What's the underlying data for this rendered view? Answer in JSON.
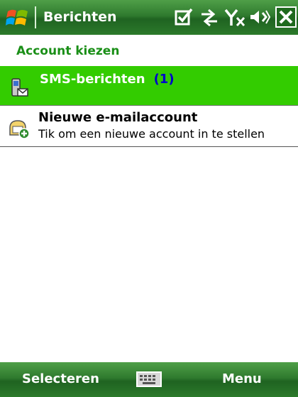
{
  "titlebar": {
    "title": "Berichten",
    "start_icon": "windows-flag-icon",
    "status_icons": [
      "checkbox-icon",
      "connectivity-arrows-icon",
      "no-signal-icon",
      "volume-icon",
      "close-icon"
    ]
  },
  "subheader": {
    "text": "Account kiezen"
  },
  "accounts": [
    {
      "icon": "sms-phone-icon",
      "label": "SMS-berichten",
      "count": "(1)"
    },
    {
      "icon": "new-email-account-icon",
      "title": "Nieuwe e-mailaccount",
      "subtitle": "Tik om een nieuwe account in te stellen"
    }
  ],
  "softkeys": {
    "left": "Selecteren",
    "right": "Menu",
    "center_icon": "keyboard-icon"
  },
  "colors": {
    "bar_green": "#2f7a2e",
    "selection_green": "#33cc00",
    "header_green": "#1a8f17",
    "count_blue": "#0000cc"
  }
}
